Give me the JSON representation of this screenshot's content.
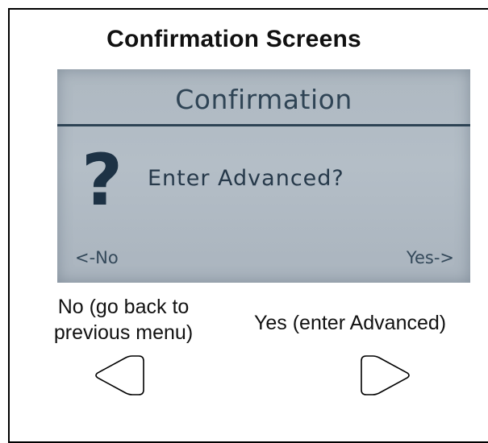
{
  "heading": "Confirmation Screens",
  "lcd": {
    "title": "Confirmation",
    "icon": "question-mark-icon",
    "icon_glyph": "?",
    "prompt": "Enter Advanced?",
    "no_hint": "<-No",
    "yes_hint": "Yes->"
  },
  "captions": {
    "no_line1": "No (go back to",
    "no_line2": "previous menu)",
    "yes": "Yes (enter Advanced)"
  },
  "softkeys": {
    "left_icon": "left-arrow-key-icon",
    "right_icon": "right-arrow-key-icon"
  },
  "colors": {
    "lcd_background": "#b2bcc5",
    "lcd_text": "#2f4455",
    "outline": "#000000"
  }
}
